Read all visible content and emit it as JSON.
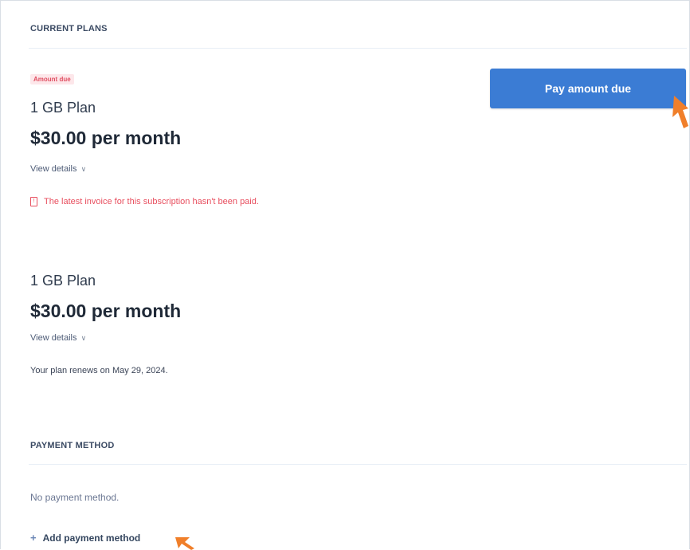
{
  "current_plans": {
    "section_title": "CURRENT PLANS",
    "plans": [
      {
        "badge": "Amount due",
        "name": "1 GB Plan",
        "price": "$30.00 per month",
        "details_link": "View details",
        "warning": "The latest invoice for this subscription hasn't been paid.",
        "warning_icon": "alert-icon"
      },
      {
        "name": "1 GB Plan",
        "price": "$30.00 per month",
        "details_link": "View details",
        "renewal_text": "Your plan renews on May 29, 2024."
      }
    ],
    "pay_button_label": "Pay amount due"
  },
  "payment_method": {
    "section_title": "PAYMENT METHOD",
    "empty_text": "No payment method.",
    "add_label": "Add payment method",
    "add_icon": "plus-icon"
  },
  "colors": {
    "primary": "#3b7cd4",
    "danger": "#e84f5f",
    "cursor": "#f07f2a"
  },
  "icons": {
    "chevron": "chevron-down-icon",
    "cursor": "mouse-pointer-icon"
  }
}
